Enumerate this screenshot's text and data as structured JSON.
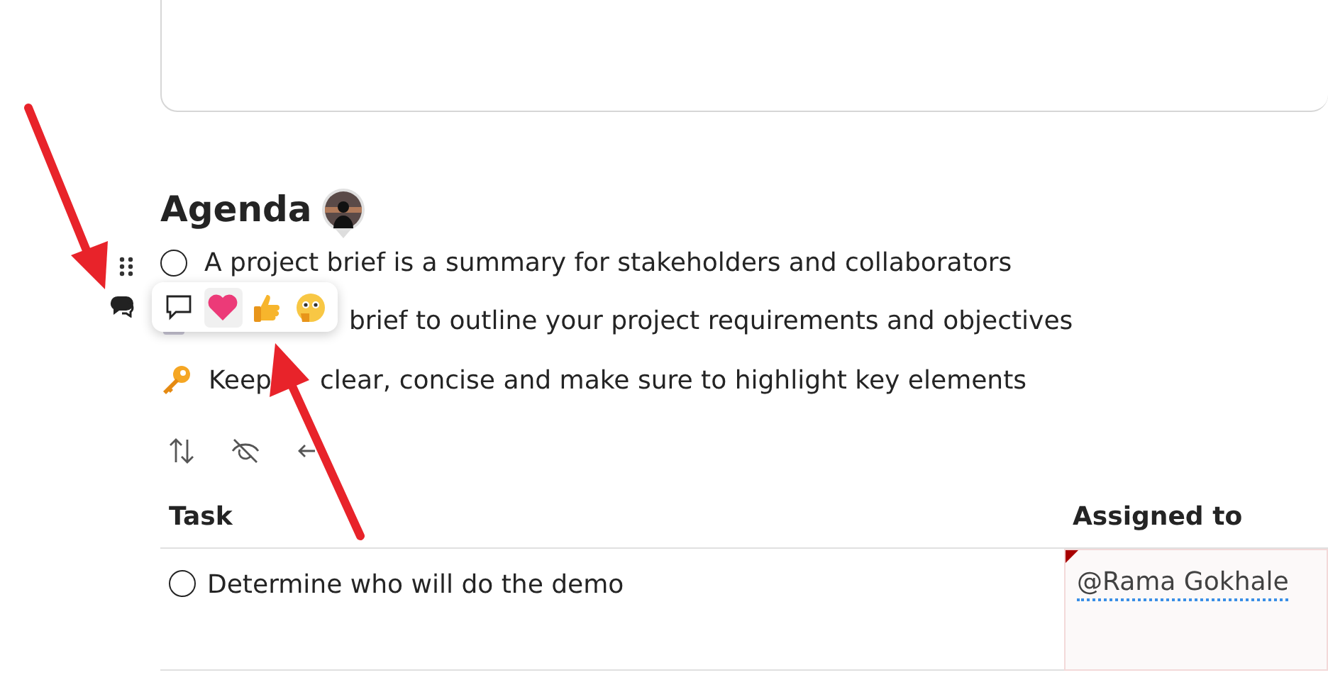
{
  "heading": "Agenda",
  "items": [
    {
      "kind": "checkbox",
      "checked": false,
      "text": "A project brief is a summary for stakeholders and collaborators"
    },
    {
      "kind": "document",
      "covered_start": true,
      "segments": [
        "brief to outline your project requirements and objectives"
      ]
    },
    {
      "kind": "key",
      "segments": [
        "Keep",
        "clear, concise and make sure to highlight key elements"
      ]
    }
  ],
  "table": {
    "columns": [
      "Task",
      "Assigned to"
    ],
    "rows": [
      {
        "checked": false,
        "task": "Determine who will do the demo",
        "assigned": "@Rama Gokhale"
      }
    ]
  }
}
